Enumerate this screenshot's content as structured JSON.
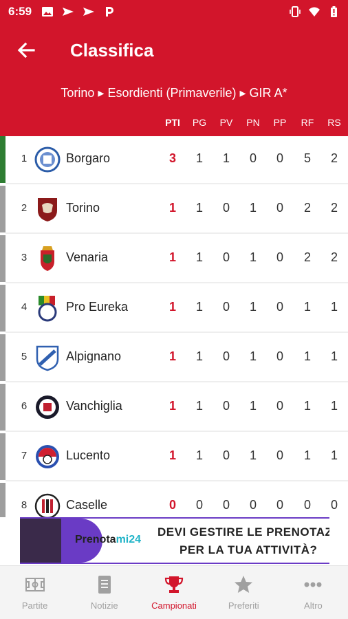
{
  "status_bar": {
    "time": "6:59",
    "left_icons": [
      "image-icon",
      "send-icon",
      "send-icon",
      "p-app-icon"
    ],
    "right_icons": [
      "vibrate-icon",
      "wifi-icon",
      "battery-icon"
    ]
  },
  "header": {
    "title": "Classifica",
    "back_icon": "arrow-left-icon"
  },
  "breadcrumb": "Torino ▸ Esordienti (Primaverile) ▸ GIR A*",
  "columns": [
    "PTI",
    "PG",
    "PV",
    "PN",
    "PP",
    "RF",
    "RS"
  ],
  "standings": [
    {
      "pos": "1",
      "team": "Borgaro",
      "pti": "3",
      "pg": "1",
      "pv": "1",
      "pn": "0",
      "pp": "0",
      "rf": "5",
      "rs": "2",
      "stripe_color": "#2e7d32"
    },
    {
      "pos": "2",
      "team": "Torino",
      "pti": "1",
      "pg": "1",
      "pv": "0",
      "pn": "1",
      "pp": "0",
      "rf": "2",
      "rs": "2",
      "stripe_color": "#9e9e9e"
    },
    {
      "pos": "3",
      "team": "Venaria",
      "pti": "1",
      "pg": "1",
      "pv": "0",
      "pn": "1",
      "pp": "0",
      "rf": "2",
      "rs": "2",
      "stripe_color": "#9e9e9e"
    },
    {
      "pos": "4",
      "team": "Pro Eureka",
      "pti": "1",
      "pg": "1",
      "pv": "0",
      "pn": "1",
      "pp": "0",
      "rf": "1",
      "rs": "1",
      "stripe_color": "#9e9e9e"
    },
    {
      "pos": "5",
      "team": "Alpignano",
      "pti": "1",
      "pg": "1",
      "pv": "0",
      "pn": "1",
      "pp": "0",
      "rf": "1",
      "rs": "1",
      "stripe_color": "#9e9e9e"
    },
    {
      "pos": "6",
      "team": "Vanchiglia",
      "pti": "1",
      "pg": "1",
      "pv": "0",
      "pn": "1",
      "pp": "0",
      "rf": "1",
      "rs": "1",
      "stripe_color": "#9e9e9e"
    },
    {
      "pos": "7",
      "team": "Lucento",
      "pti": "1",
      "pg": "1",
      "pv": "0",
      "pn": "1",
      "pp": "0",
      "rf": "1",
      "rs": "1",
      "stripe_color": "#9e9e9e"
    },
    {
      "pos": "8",
      "team": "Caselle",
      "pti": "0",
      "pg": "0",
      "pv": "0",
      "pn": "0",
      "pp": "0",
      "rf": "0",
      "rs": "0",
      "stripe_color": "#9e9e9e"
    }
  ],
  "ad": {
    "brand_main": "Prenota",
    "brand_accent": "mi24",
    "line1": "DEVI GESTIRE LE PRENOTAZIONI",
    "line2": "PER LA TUA ATTIVITÀ?"
  },
  "bottom_nav": [
    {
      "label": "Partite",
      "icon": "field-icon",
      "active": false
    },
    {
      "label": "Notizie",
      "icon": "news-icon",
      "active": false
    },
    {
      "label": "Campionati",
      "icon": "trophy-icon",
      "active": true
    },
    {
      "label": "Preferiti",
      "icon": "star-icon",
      "active": false
    },
    {
      "label": "Altro",
      "icon": "more-dots-icon",
      "active": false
    }
  ],
  "colors": {
    "primary_red": "#d2152b",
    "leader_green": "#2e7d32",
    "stripe_gray": "#9e9e9e",
    "nav_inactive": "#a0a0a0"
  }
}
